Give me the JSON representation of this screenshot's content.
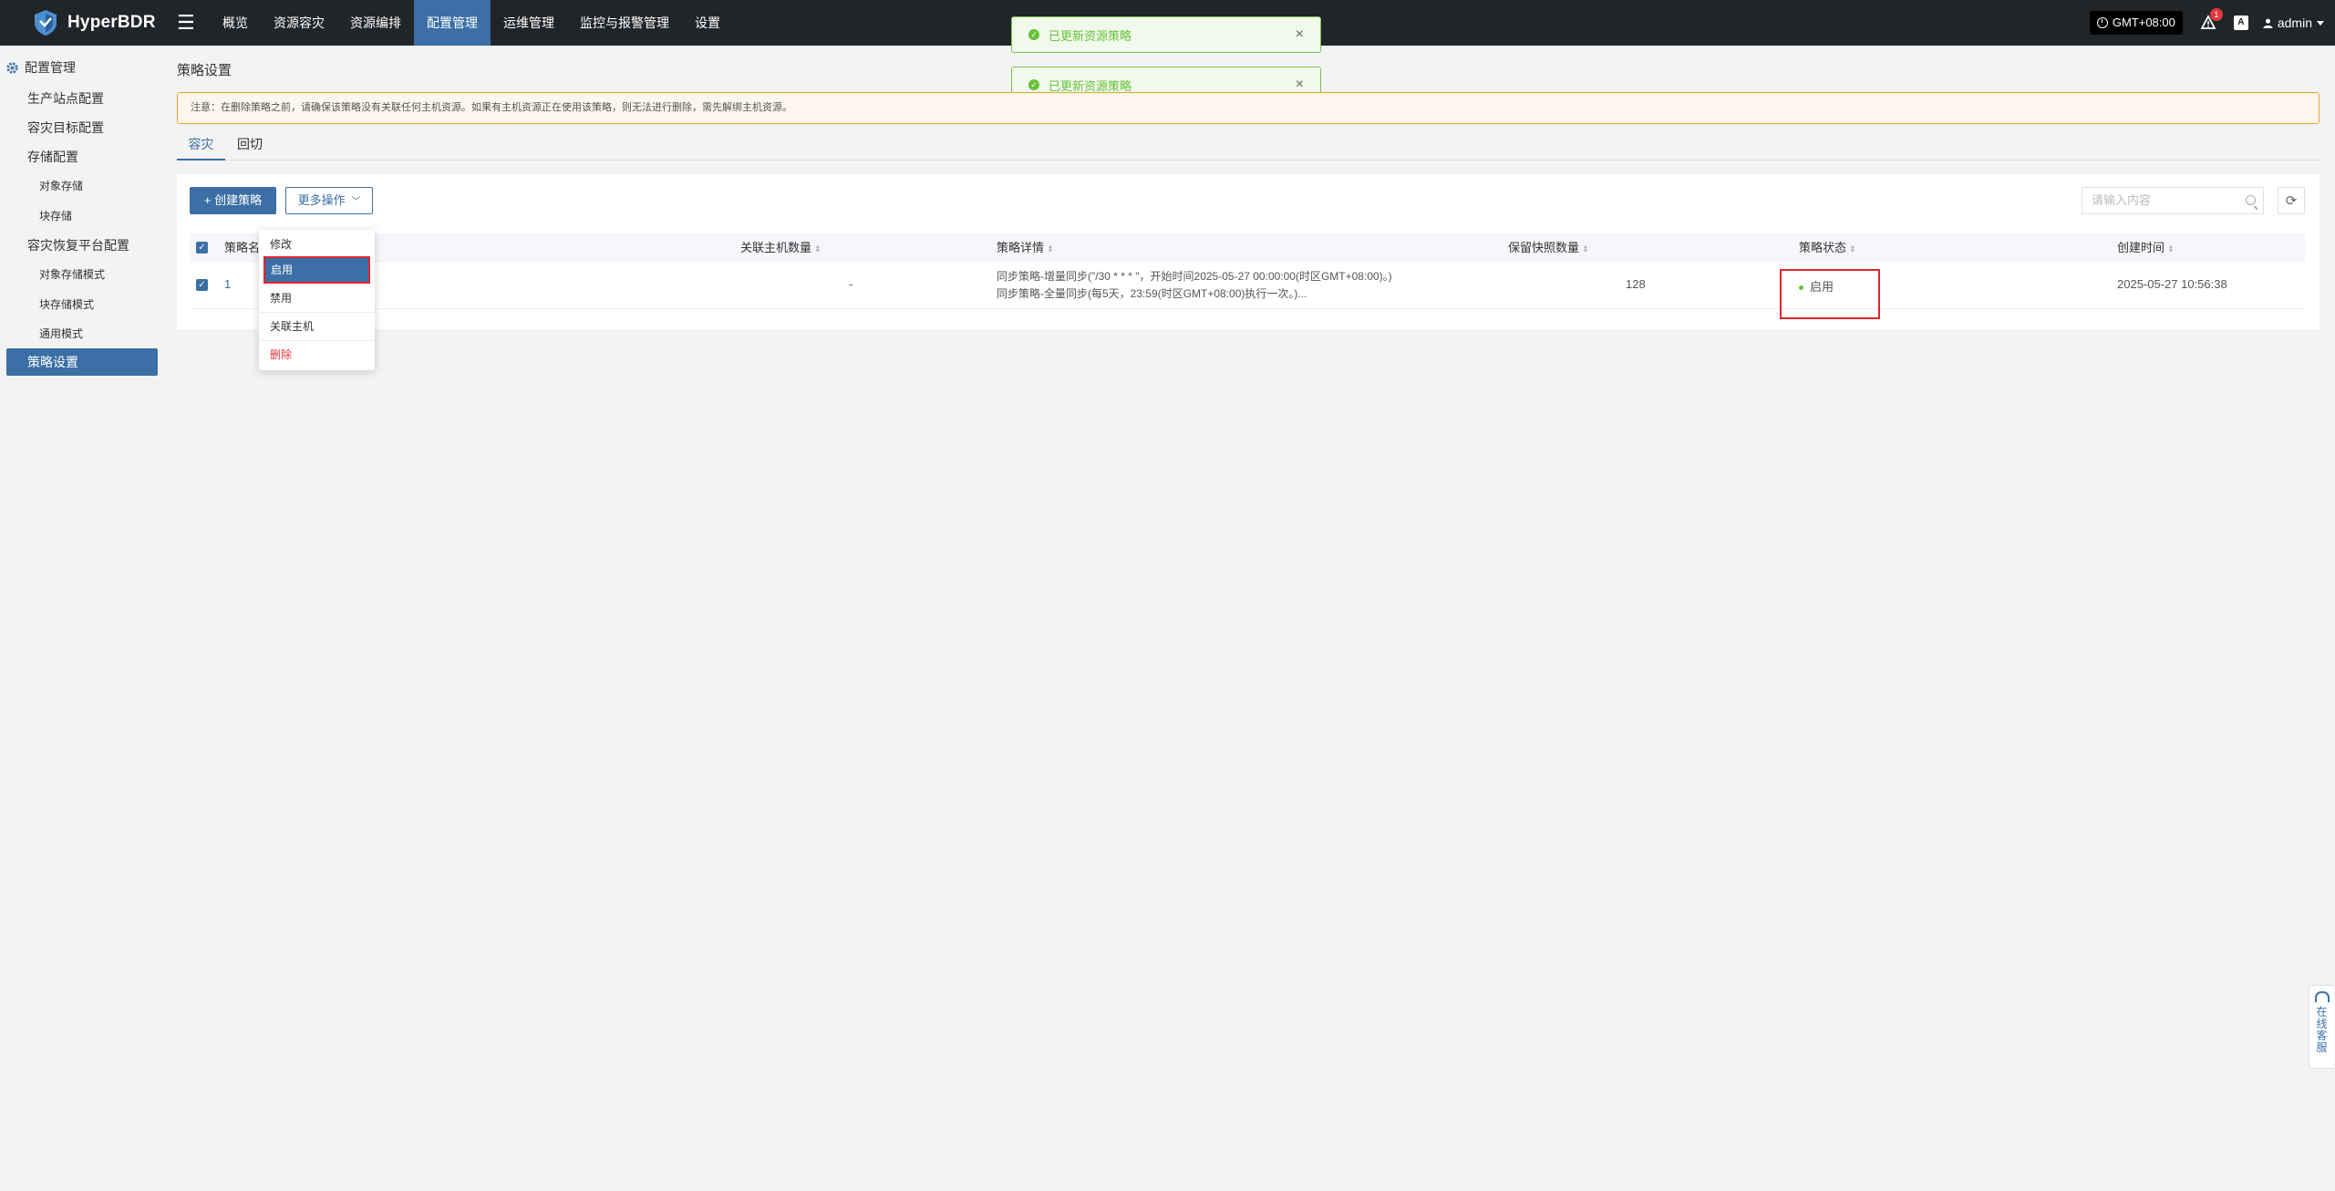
{
  "header": {
    "brand": "HyperBDR",
    "nav": [
      "概览",
      "资源容灾",
      "资源编排",
      "配置管理",
      "运维管理",
      "监控与报警管理",
      "设置"
    ],
    "active_nav": "配置管理",
    "timezone": "GMT+08:00",
    "alert_count": "1",
    "lang_icon": "A",
    "user": "admin"
  },
  "toasts": [
    {
      "message": "已更新资源策略"
    },
    {
      "message": "已更新资源策略"
    }
  ],
  "sidebar": {
    "title": "配置管理",
    "items": [
      {
        "label": "生产站点配置"
      },
      {
        "label": "容灾目标配置"
      },
      {
        "label": "存储配置"
      },
      {
        "label": "对象存储"
      },
      {
        "label": "块存储"
      },
      {
        "label": "容灾恢复平台配置"
      },
      {
        "label": "对象存储模式"
      },
      {
        "label": "块存储模式"
      },
      {
        "label": "通用模式"
      },
      {
        "label": "策略设置"
      }
    ]
  },
  "main": {
    "page_title": "策略设置",
    "notice": "注意：在删除策略之前，请确保该策略没有关联任何主机资源。如果有主机资源正在使用该策略，则无法进行删除，需先解绑主机资源。",
    "tabs": [
      {
        "label": "容灾"
      },
      {
        "label": "回切"
      }
    ],
    "toolbar": {
      "create_label": "+ 创建策略",
      "more_label": "更多操作",
      "search_placeholder": "请输入内容"
    },
    "table": {
      "headers": {
        "name": "策略名",
        "hosts": "关联主机数量",
        "detail": "策略详情",
        "snapshots": "保留快照数量",
        "status": "策略状态",
        "created": "创建时间"
      },
      "rows": [
        {
          "name": "1",
          "hosts": "-",
          "detail_line1": "同步策略-增量同步(\"/30 * * * \"，开始时间2025-05-27 00:00:00(时区GMT+08:00)。)",
          "detail_line2": "同步策略-全量同步(每5天，23:59(时区GMT+08:00)执行一次。)...",
          "snapshots": "128",
          "status": "启用",
          "created": "2025-05-27 10:56:38"
        }
      ]
    },
    "dropdown": {
      "items": [
        {
          "label": "修改"
        },
        {
          "label": "启用"
        },
        {
          "label": "禁用"
        },
        {
          "label": "关联主机"
        },
        {
          "label": "删除"
        }
      ],
      "selected": "启用"
    }
  },
  "float_service": {
    "label": "在线客服"
  },
  "colors": {
    "topbar": "#222528",
    "accent": "#3b6fa5",
    "success": "#67c23a",
    "warning_border": "#e6a23c",
    "highlight": "#e0262c"
  }
}
